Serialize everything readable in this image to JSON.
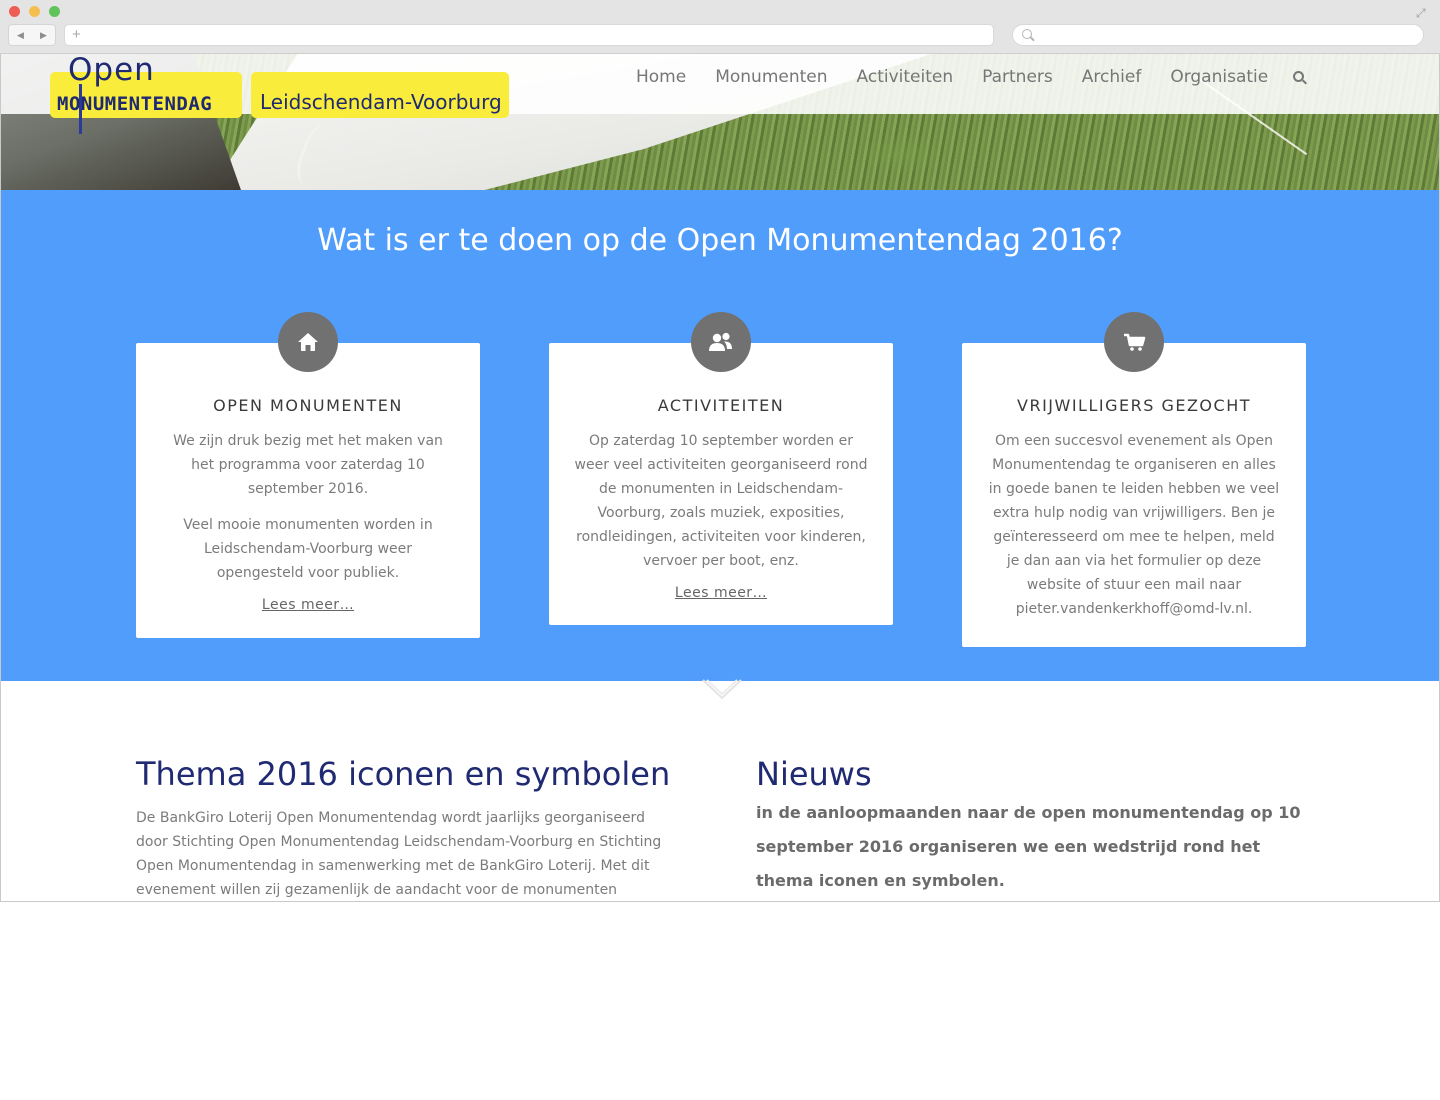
{
  "browser": {
    "nav_back": "◀",
    "nav_forward": "▶",
    "new_tab": "+"
  },
  "site": {
    "logo_open": "Open",
    "logo_monumentendag": "MONUMENTENDAG",
    "logo_town": "Leidschendam-Voorburg",
    "menu": [
      "Home",
      "Monumenten",
      "Activiteiten",
      "Partners",
      "Archief",
      "Organisatie"
    ]
  },
  "intro": {
    "heading": "Wat is er te doen op de Open Monumentendag 2016?"
  },
  "cards": [
    {
      "icon": "home-icon",
      "title": "OPEN MONUMENTEN",
      "paragraphs": [
        "We zijn druk bezig met het maken van het programma voor zaterdag 10 september 2016.",
        "Veel mooie monumenten worden in Leidschendam-Voorburg weer opengesteld voor publiek."
      ],
      "more": "Lees meer…"
    },
    {
      "icon": "users-icon",
      "title": "ACTIVITEITEN",
      "paragraphs": [
        "Op zaterdag 10 september worden er weer veel activiteiten georganiseerd rond de monumenten in Leidschendam-Voorburg, zoals muziek, exposities, rondleidingen, activiteiten voor kinderen, vervoer per boot, enz."
      ],
      "more": "Lees meer…"
    },
    {
      "icon": "cart-icon",
      "title": "VRIJWILLIGERS GEZOCHT",
      "paragraphs": [
        "Om een succesvol evenement als Open Monumentendag te organiseren en alles in goede banen te leiden hebben we veel extra hulp nodig van vrijwilligers. Ben je geïnteresseerd om mee te helpen, meld je dan aan via het formulier op deze website of stuur een mail naar pieter.vandenkerkhoff@omd-lv.nl."
      ]
    }
  ],
  "thema": {
    "heading": "Thema 2016 iconen en symbolen",
    "text": "De BankGiro Loterij Open Monumentendag wordt jaarlijks georganiseerd door Stichting Open Monumentendag Leidschendam-Voorburg en Stichting Open Monumentendag in samenwerking met de BankGiro Loterij. Met dit evenement willen zij gezamenlijk de aandacht voor de monumenten vergroten door dit"
  },
  "nieuws": {
    "heading": "Nieuws",
    "text": "in de aanloopmaanden naar de open monumentendag op 10 september 2016 organiseren we een wedstrijd rond het thema iconen en symbolen."
  },
  "colors": {
    "accent_blue": "#519dfc",
    "logo_yellow": "#f9ec3a",
    "heading_navy": "#1f2a72",
    "icon_grey": "#717171"
  }
}
